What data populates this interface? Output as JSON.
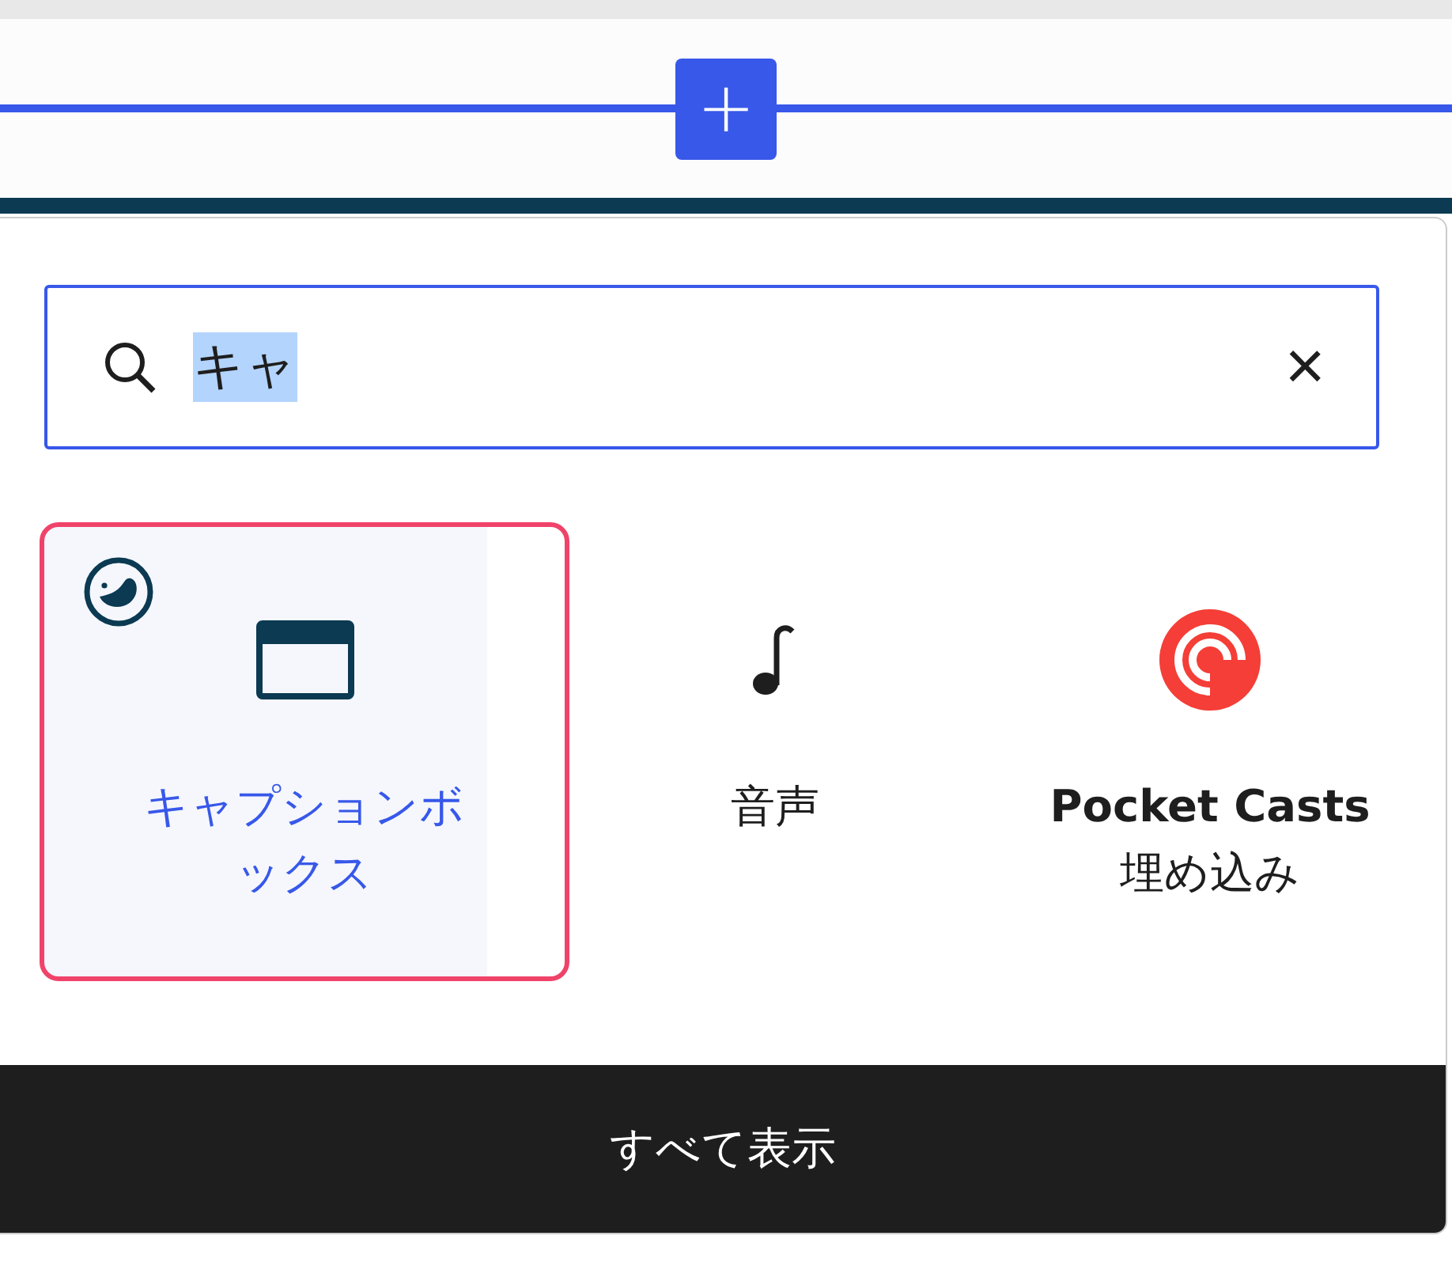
{
  "inserter_button": {
    "label": "+"
  },
  "search": {
    "value": "キャ",
    "text_selected": true,
    "clear_label": "×"
  },
  "blocks": [
    {
      "label": "キャプションボックス",
      "kind": "caption-box",
      "selected": true,
      "plugin_badge": true
    },
    {
      "label": "音声",
      "kind": "audio",
      "selected": false,
      "plugin_badge": false
    },
    {
      "label": "**Pocket Casts**\n埋め込み",
      "kind": "pocket-casts",
      "selected": false,
      "plugin_badge": false
    }
  ],
  "footer_button": {
    "label": "すべて表示"
  }
}
